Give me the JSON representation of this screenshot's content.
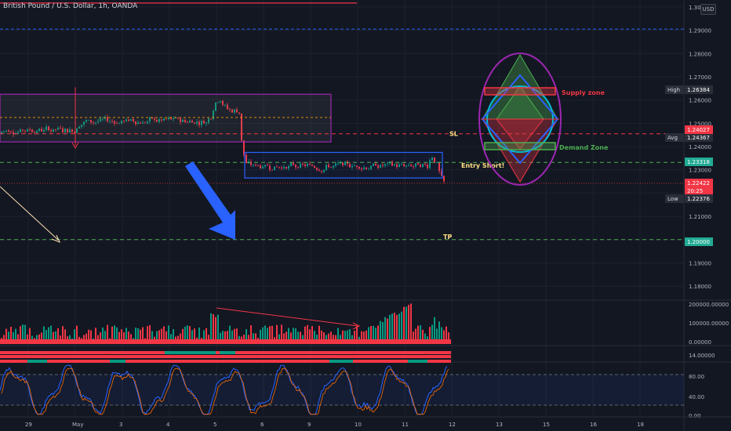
{
  "header": {
    "symbol_title": "British Pound / U.S. Dollar, 1h, OANDA"
  },
  "currency_button": "USD",
  "chart_data": {
    "type": "candlestick",
    "instrument": "British Pound / U.S. Dollar",
    "timeframe": "1h",
    "broker": "OANDA",
    "y_range": [
      1.175,
      1.303
    ],
    "price_ticks": [
      "1.30000",
      "1.29000",
      "1.28000",
      "1.27000",
      "1.26000",
      "1.25000",
      "1.24000",
      "1.23000",
      "1.22000",
      "1.21000",
      "1.20000",
      "1.19000",
      "1.18000"
    ],
    "x_labels": [
      "29",
      "May",
      "3",
      "4",
      "5",
      "6",
      "9",
      "10",
      "11",
      "12",
      "13",
      "15",
      "16",
      "18"
    ],
    "price_tags": [
      {
        "label": "High",
        "value": "1.26384",
        "color": "#2a2e39"
      },
      {
        "label": "Avg",
        "value": "1.24367",
        "color": "#2a2e39"
      },
      {
        "label": "",
        "value": "1.24027",
        "color": "#f23645"
      },
      {
        "label": "",
        "value": "1.23318",
        "color": "#22ab94"
      },
      {
        "label": "",
        "value": "1.22422",
        "color": "#f23645",
        "countdown": "20:25"
      },
      {
        "label": "Low",
        "value": "1.22376",
        "color": "#2a2e39"
      },
      {
        "label": "",
        "value": "1.20000",
        "color": "#22ab94"
      }
    ],
    "levels": {
      "SL": 1.2455,
      "entry": 1.2332,
      "TP": 1.2,
      "top_red_line": 1.3017,
      "blue_dashed": 1.2905
    },
    "annotations": {
      "sl": "SL",
      "entry": "Entry Short!",
      "tp": "TP",
      "supply": "Supply zone",
      "demand": "Demand Zone"
    },
    "volume_ticks": [
      "200000.00000",
      "100000.00000",
      "0.00000"
    ],
    "indicator2_ticks": [
      "14.00000"
    ],
    "oscillator_ticks": [
      "80.00",
      "40.00",
      "0.00"
    ],
    "colors": {
      "up": "#089981",
      "down": "#f23645",
      "bg": "#131722"
    }
  }
}
